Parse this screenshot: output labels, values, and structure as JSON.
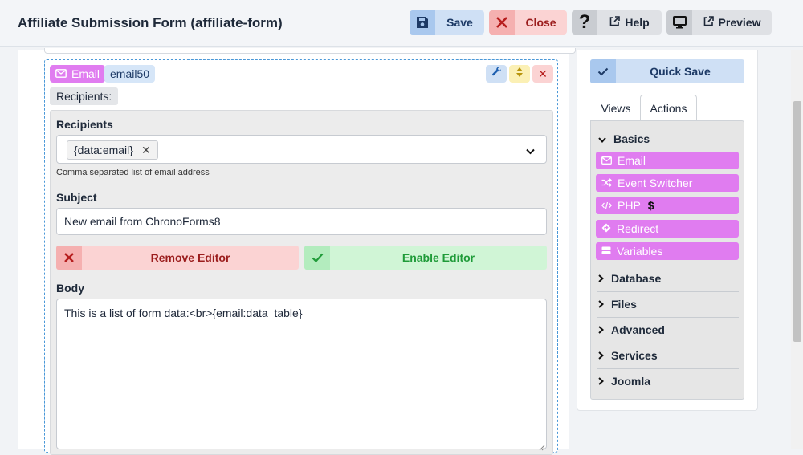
{
  "header": {
    "title": "Affiliate Submission Form (affiliate-form)",
    "save_label": "Save",
    "close_label": "Close",
    "help_label": "Help",
    "preview_label": "Preview"
  },
  "email_block": {
    "type_label": "Email",
    "id_label": "email50",
    "recipients_pill": "Recipients:",
    "recipients": {
      "label": "Recipients",
      "chip": "{data:email}",
      "help": "Comma separated list of email address"
    },
    "subject": {
      "label": "Subject",
      "value": "New email from ChronoForms8"
    },
    "remove_editor_label": "Remove Editor",
    "enable_editor_label": "Enable Editor",
    "body": {
      "label": "Body",
      "value": "This is a list of form data:<br>{email:data_table}"
    }
  },
  "sidebar": {
    "quick_save_label": "Quick Save",
    "tabs": [
      {
        "label": "Views",
        "active": false
      },
      {
        "label": "Actions",
        "active": true
      }
    ],
    "sections": {
      "basics": "Basics",
      "database": "Database",
      "files": "Files",
      "advanced": "Advanced",
      "services": "Services",
      "joomla": "Joomla"
    },
    "basics_items": [
      {
        "label": "Email",
        "icon": "envelope-icon"
      },
      {
        "label": "Event Switcher",
        "icon": "shuffle-icon"
      },
      {
        "label": "PHP",
        "icon": "code-icon",
        "suffix": "$"
      },
      {
        "label": "Redirect",
        "icon": "diamond-arrow-icon"
      },
      {
        "label": "Variables",
        "icon": "layers-icon"
      }
    ]
  },
  "colors": {
    "accent_blue": "#cfe0f5",
    "danger": "#fbd3d3",
    "success": "#d0f5d6",
    "action_pink": "#e07cf0"
  }
}
